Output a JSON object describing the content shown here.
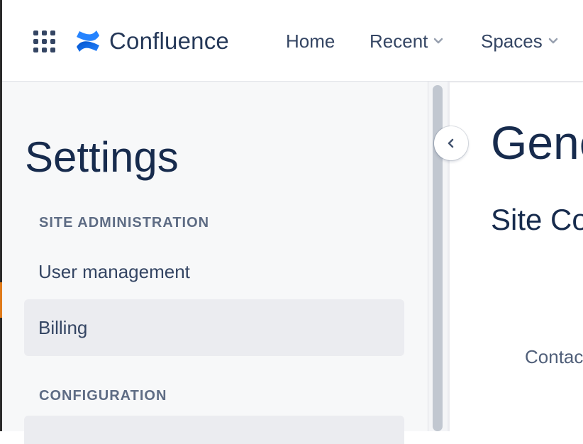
{
  "topnav": {
    "product_name": "Confluence",
    "items": [
      {
        "label": "Home",
        "has_dropdown": false
      },
      {
        "label": "Recent",
        "has_dropdown": true
      },
      {
        "label": "Spaces",
        "has_dropdown": true
      }
    ]
  },
  "sidebar": {
    "title": "Settings",
    "sections": [
      {
        "heading": "SITE ADMINISTRATION",
        "items": [
          {
            "label": "User management",
            "selected": false
          },
          {
            "label": "Billing",
            "selected": true
          }
        ]
      },
      {
        "heading": "CONFIGURATION",
        "items": []
      }
    ]
  },
  "main": {
    "title": "Gene",
    "subtitle": "Site Co",
    "contact_text": "Contac"
  },
  "icons": {
    "app_switcher": "grid-dots-icon",
    "logo": "confluence-logo-icon",
    "dropdown": "chevron-down-icon",
    "collapse": "chevron-left-icon"
  },
  "colors": {
    "brand": "#2684ff",
    "text": "#172b4d",
    "nav_text": "#344563",
    "section_heading": "#5e6c84",
    "sidebar_bg": "#f7f8f9",
    "selected_bg": "#ebecf0"
  }
}
